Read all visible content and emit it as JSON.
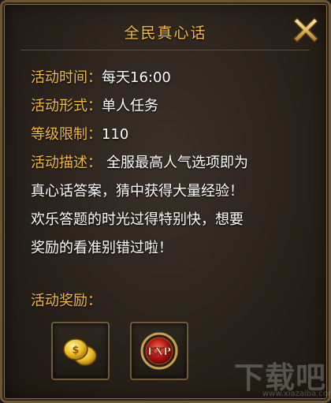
{
  "dialog": {
    "title": "全民真心话"
  },
  "info": {
    "time_label": "活动时间：",
    "time_value": "每天16:00",
    "form_label": "活动形式：",
    "form_value": "单人任务",
    "level_label": "等级限制：",
    "level_value": "110",
    "desc_label": "活动描述：",
    "desc_line1": "全服最高人气选项即为",
    "desc_line2": "真心话答案，猜中获得大量经验！",
    "desc_line3": "欢乐答题的时光过得特别快，想要",
    "desc_line4": "奖励的看准别错过啦！"
  },
  "rewards": {
    "label": "活动奖励：",
    "items": [
      {
        "icon": "gold-coins-icon"
      },
      {
        "icon": "exp-orb-icon",
        "text": "EXP"
      }
    ]
  },
  "watermark": {
    "text": "下载吧",
    "url": "www.xiazaiba.com"
  },
  "colors": {
    "accent": "#f0b848",
    "text": "#ffffff",
    "border": "#6b5638"
  }
}
